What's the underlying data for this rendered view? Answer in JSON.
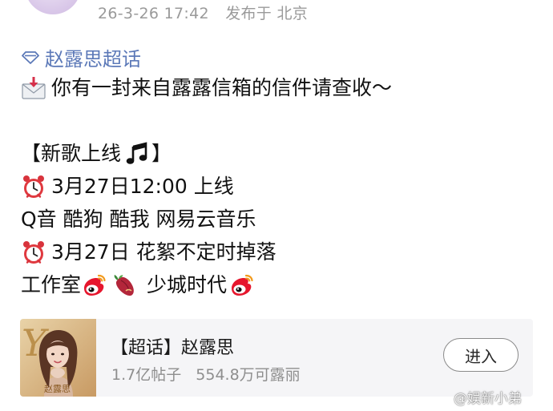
{
  "post": {
    "timestamp": "26-3-26 17:42",
    "location": "发布于 北京"
  },
  "topic": {
    "label": "赵露思超话",
    "icon": "diamond-icon",
    "color": "#5c79b8"
  },
  "content": {
    "line1": "你有一封来自露露信箱的信件请查收～",
    "line2": "【新歌上线",
    "line2_end": "】",
    "line3": "3月27日12:00 上线",
    "line4": "Q音 酷狗 酷我 网易云音乐",
    "line5": "3月27日 花絮不定时掉落",
    "line6_a": "工作室",
    "line6_b": "少城时代"
  },
  "icons": {
    "envelope": "envelope-icon",
    "music": "music-note-icon",
    "alarm": "alarm-clock-icon",
    "weibo": "weibo-icon",
    "sweet_potato": "sweet-potato-icon"
  },
  "card": {
    "title": "【超话】赵露思",
    "posts": "1.7亿帖子",
    "members": "554.8万可露丽",
    "button": "进入",
    "cover_text": "赵露思"
  },
  "watermark": {
    "text": "@娱新小弟"
  }
}
